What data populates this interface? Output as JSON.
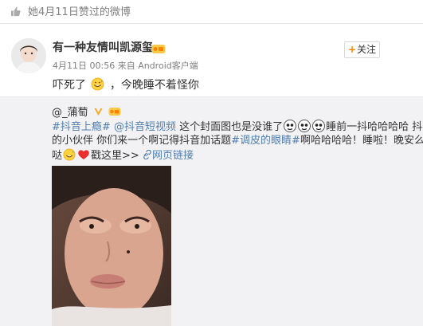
{
  "liked_bar": {
    "icon": "thumb-up-icon",
    "text": "她4月11日赞过的微博"
  },
  "post": {
    "username": "有一种友情叫凯源玺",
    "time": "4月11日 00:56",
    "source_prefix": "来自",
    "source": "Android客户端",
    "follow_plus": "+",
    "follow_label": "关注",
    "text_before": "吓死了",
    "text_after": "，今晚睡不着怪你"
  },
  "repost": {
    "author_at": "@",
    "author": "_蒲萄",
    "topic1": "#抖音上瘾#",
    "mention": "@抖音短视频",
    "text1": "这个封面图也是没谁了",
    "text2": "睡前一抖哈哈哈哈",
    "text3": "抖音",
    "text4": "的小伙伴 你们来一个啊记得抖音加话题",
    "topic2": "#调皮的眼睛#",
    "text5": "啊哈哈哈哈！睡啦！晚安么么",
    "text6": "哒",
    "text7": "戳这里>>",
    "link_icon": "link-icon",
    "link_label": "网页链接"
  },
  "colors": {
    "link": "#507daf",
    "accent": "#ff8200",
    "meta": "#808080",
    "repost_bg": "#f2f2f5"
  }
}
